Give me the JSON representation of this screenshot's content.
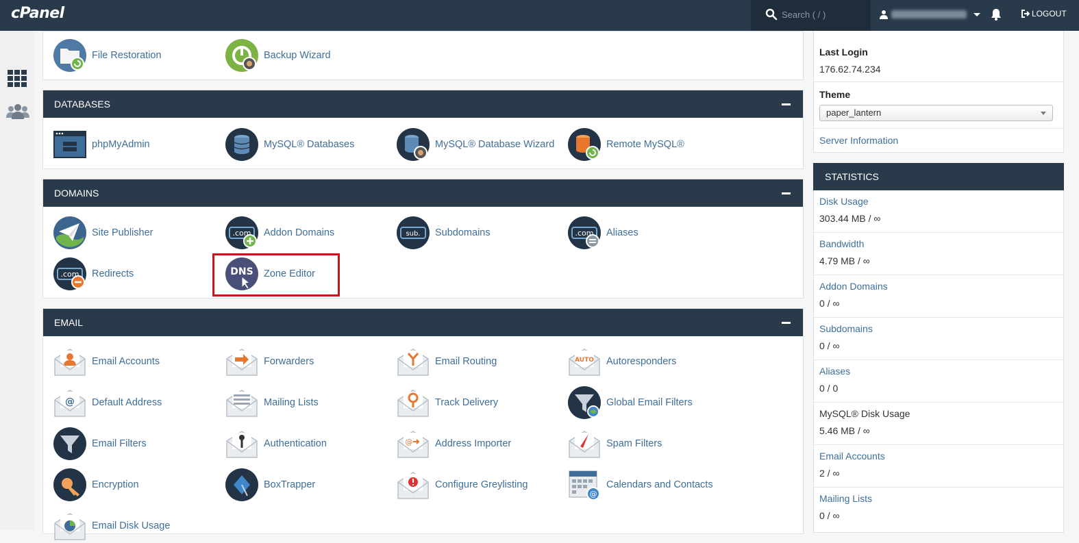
{
  "header": {
    "logo": "cPanel",
    "search_placeholder": "Search ( / )",
    "logout_label": "LOGOUT"
  },
  "files": {
    "items": [
      {
        "label": "File Restoration",
        "icon": "file-restoration-icon"
      },
      {
        "label": "Backup Wizard",
        "icon": "backup-wizard-icon"
      }
    ]
  },
  "databases": {
    "title": "DATABASES",
    "items": [
      {
        "label": "phpMyAdmin",
        "icon": "phpmyadmin-icon"
      },
      {
        "label": "MySQL® Databases",
        "icon": "mysql-databases-icon"
      },
      {
        "label": "MySQL® Database Wizard",
        "icon": "mysql-wizard-icon"
      },
      {
        "label": "Remote MySQL®",
        "icon": "remote-mysql-icon"
      }
    ]
  },
  "domains": {
    "title": "DOMAINS",
    "items": [
      {
        "label": "Site Publisher",
        "icon": "site-publisher-icon"
      },
      {
        "label": "Addon Domains",
        "icon": "addon-domains-icon"
      },
      {
        "label": "Subdomains",
        "icon": "subdomains-icon"
      },
      {
        "label": "Aliases",
        "icon": "aliases-icon"
      },
      {
        "label": "Redirects",
        "icon": "redirects-icon"
      },
      {
        "label": "Zone Editor",
        "icon": "zone-editor-icon"
      }
    ]
  },
  "email": {
    "title": "EMAIL",
    "items": [
      {
        "label": "Email Accounts"
      },
      {
        "label": "Forwarders"
      },
      {
        "label": "Email Routing"
      },
      {
        "label": "Autoresponders"
      },
      {
        "label": "Default Address"
      },
      {
        "label": "Mailing Lists"
      },
      {
        "label": "Track Delivery"
      },
      {
        "label": "Global Email Filters"
      },
      {
        "label": "Email Filters"
      },
      {
        "label": "Authentication"
      },
      {
        "label": "Address Importer"
      },
      {
        "label": "Spam Filters"
      },
      {
        "label": "Encryption"
      },
      {
        "label": "BoxTrapper"
      },
      {
        "label": "Configure Greylisting"
      },
      {
        "label": "Calendars and Contacts"
      },
      {
        "label": "Email Disk Usage"
      }
    ]
  },
  "general_info": {
    "last_login_label": "Last Login",
    "last_login_value": "176.62.74.234",
    "theme_label": "Theme",
    "theme_value": "paper_lantern",
    "server_info_link": "Server Information"
  },
  "statistics": {
    "title": "STATISTICS",
    "rows": [
      {
        "label": "Disk Usage",
        "value": "303.44 MB / ∞"
      },
      {
        "label": "Bandwidth",
        "value": "4.79 MB / ∞"
      },
      {
        "label": "Addon Domains",
        "value": "0 / ∞"
      },
      {
        "label": "Subdomains",
        "value": "0 / ∞"
      },
      {
        "label": "Aliases",
        "value": "0 / 0"
      },
      {
        "label": "MySQL® Disk Usage",
        "value": "5.46 MB / ∞"
      },
      {
        "label": "Email Accounts",
        "value": "2 / ∞"
      },
      {
        "label": "Mailing Lists",
        "value": "0 / ∞"
      }
    ]
  },
  "colors": {
    "header_bg": "#293a4a",
    "link": "#3e6e9a",
    "highlight": "#c4161c"
  }
}
